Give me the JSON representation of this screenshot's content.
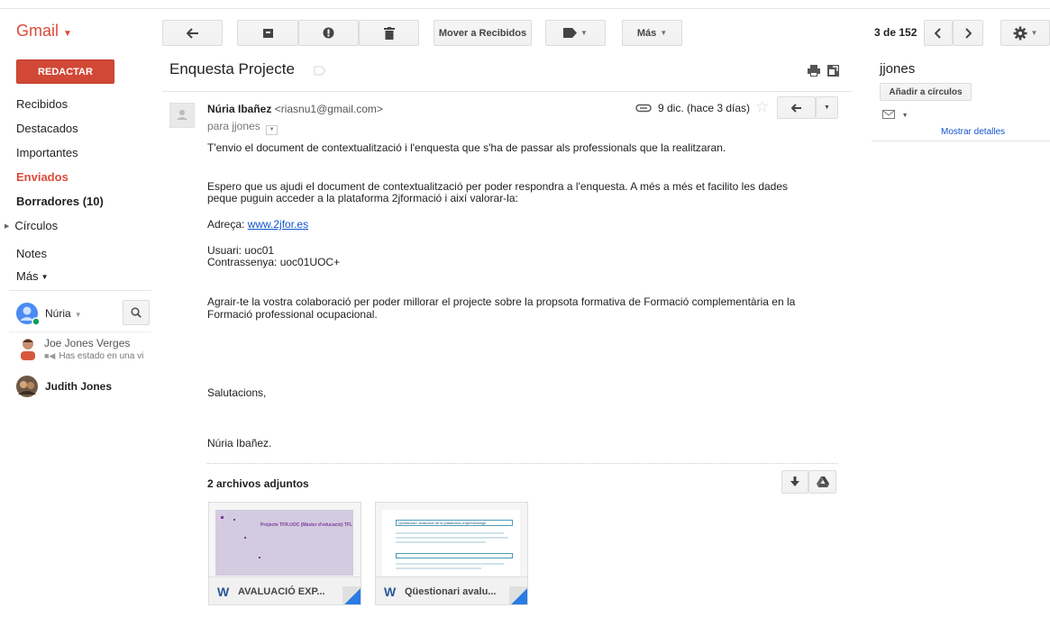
{
  "app": {
    "logo": "Gmail"
  },
  "toolbar": {
    "move_to_inbox_label": "Mover a Recibidos",
    "more_label": "Más",
    "pagination": "3 de 152"
  },
  "sidebar": {
    "compose_label": "REDACTAR",
    "items": [
      {
        "label": "Recibidos"
      },
      {
        "label": "Destacados"
      },
      {
        "label": "Importantes"
      },
      {
        "label": "Enviados"
      },
      {
        "label": "Borradores (10)"
      },
      {
        "label": "Círculos"
      },
      {
        "label": "Notes"
      },
      {
        "label": "Más"
      }
    ],
    "chat": {
      "user": "Núria",
      "contacts": [
        {
          "name": "Joe Jones Verges",
          "status": "Has estado en una vi"
        },
        {
          "name": "Judith Jones",
          "status": ""
        }
      ]
    }
  },
  "email": {
    "subject": "Enquesta Projecte",
    "sender_name": "Núria Ibañez",
    "sender_email": "<riasnu1@gmail.com>",
    "recipient": "para jjones",
    "date": "9 dic. (hace 3 días)",
    "body": {
      "p1": "T'envio el document de contextualització i l'enquesta que s'ha de passar als professionals que la realitzaran.",
      "p2_line1": "Espero que us ajudi el document de contextualització per poder respondra a l'enquesta. A més a més et facilito les dades",
      "p2_line2": "peque puguin acceder a la plataforma 2jformació i així valorar-la:",
      "address_label": "Adreça:",
      "address_link": "www.2jfor.es",
      "user_line": "Usuari: uoc01",
      "password_line": "Contrassenya: uoc01UOC+",
      "p3_line1": "Agrair-te la vostra colaboració per poder millorar el projecte sobre la propsota formativa de Formació complementària en la",
      "p3_line2": "Formació professional ocupacional.",
      "greeting": "Salutacions,",
      "signature": "Núria Ibañez."
    },
    "attachments_title": "2 archivos adjuntos",
    "attachments": [
      {
        "name": "AVALUACIÓ EXP...",
        "thumb_text": "Projecte TFR.UOC (Màster d'educació) TFL"
      },
      {
        "name": "Qüestionari avalu...",
        "thumb_text": "Qüestionari: Avaluació de la plataforma d'aprenentatge"
      }
    ]
  },
  "contact_panel": {
    "name": "jjones",
    "add_circles_label": "Añadir a círculos",
    "show_details": "Mostrar detalles"
  },
  "colors": {
    "gmail_red": "#dd4b39",
    "link_blue": "#15c",
    "compose_red": "#d14836"
  }
}
